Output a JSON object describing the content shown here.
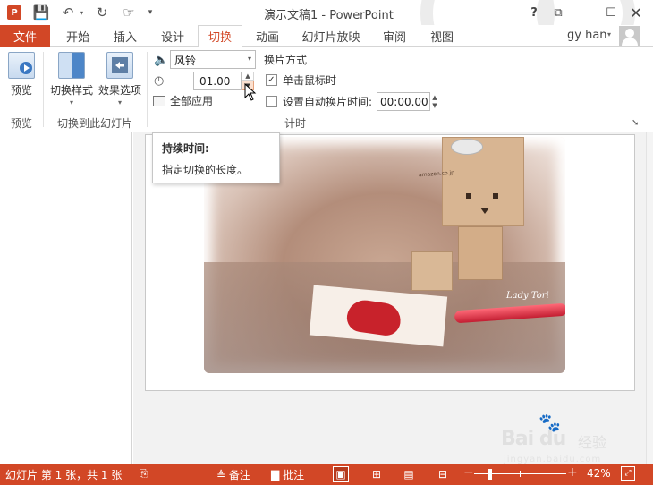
{
  "window": {
    "title": "演示文稿1 - PowerPoint",
    "help": "?",
    "ribbon_display": "⧉",
    "minimize": "—",
    "maximize": "☐",
    "close": "✕"
  },
  "qat": {
    "app_icon": "P",
    "save": "💾",
    "undo": "↶",
    "undo_more": "▾",
    "redo": "↻",
    "touch": "☞",
    "customize": "▾"
  },
  "tabs": {
    "file": "文件",
    "items": [
      {
        "label": "开始"
      },
      {
        "label": "插入"
      },
      {
        "label": "设计"
      },
      {
        "label": "切换"
      },
      {
        "label": "动画"
      },
      {
        "label": "幻灯片放映"
      },
      {
        "label": "审阅"
      },
      {
        "label": "视图"
      }
    ],
    "active": "切换"
  },
  "user": {
    "name": "gy han",
    "drop": "▾"
  },
  "ribbon": {
    "preview_btn": "预览",
    "preview_group": "预览",
    "transition_style_btn": "切换样式",
    "effect_options_btn": "效果选项",
    "transition_group": "切换到此幻灯片",
    "drop_arrow": "▾",
    "sound_icon": "🔈",
    "sound_value": "风铃",
    "select_arrow": "▾",
    "clock_icon": "◷",
    "duration_value": "01.00",
    "spin_up": "▲",
    "spin_down": "▼",
    "apply_all": "全部应用",
    "advance_title": "换片方式",
    "on_click_label": "单击鼠标时",
    "on_click_checked": "✓",
    "after_label": "设置自动换片时间:",
    "after_value": "00:00.00",
    "timing_group": "计时",
    "pin": "➘"
  },
  "tooltip": {
    "title": "持续时间:",
    "description": "指定切换的长度。"
  },
  "slide_photo": {
    "printed_text": "amazon.co.jp",
    "signature": "Lady Tori"
  },
  "watermark": {
    "logo": "Bai du",
    "paw": "🐾",
    "jingyan": "经验",
    "url": "jingyan.baidu.com"
  },
  "status": {
    "slide_info": "幻灯片 第 1 张，共 1 张",
    "lang_icon": "⎘",
    "notes": "备注",
    "comments": "批注",
    "notes_icon": "≜",
    "comments_icon": "▇",
    "view_normal": "▣",
    "view_sorter": "⊞",
    "view_reading": "▤",
    "view_show": "⊟",
    "zoom_minus": "−",
    "zoom_plus": "+",
    "zoom": "42%",
    "fit": "⤢",
    "accent": "#d24726"
  }
}
